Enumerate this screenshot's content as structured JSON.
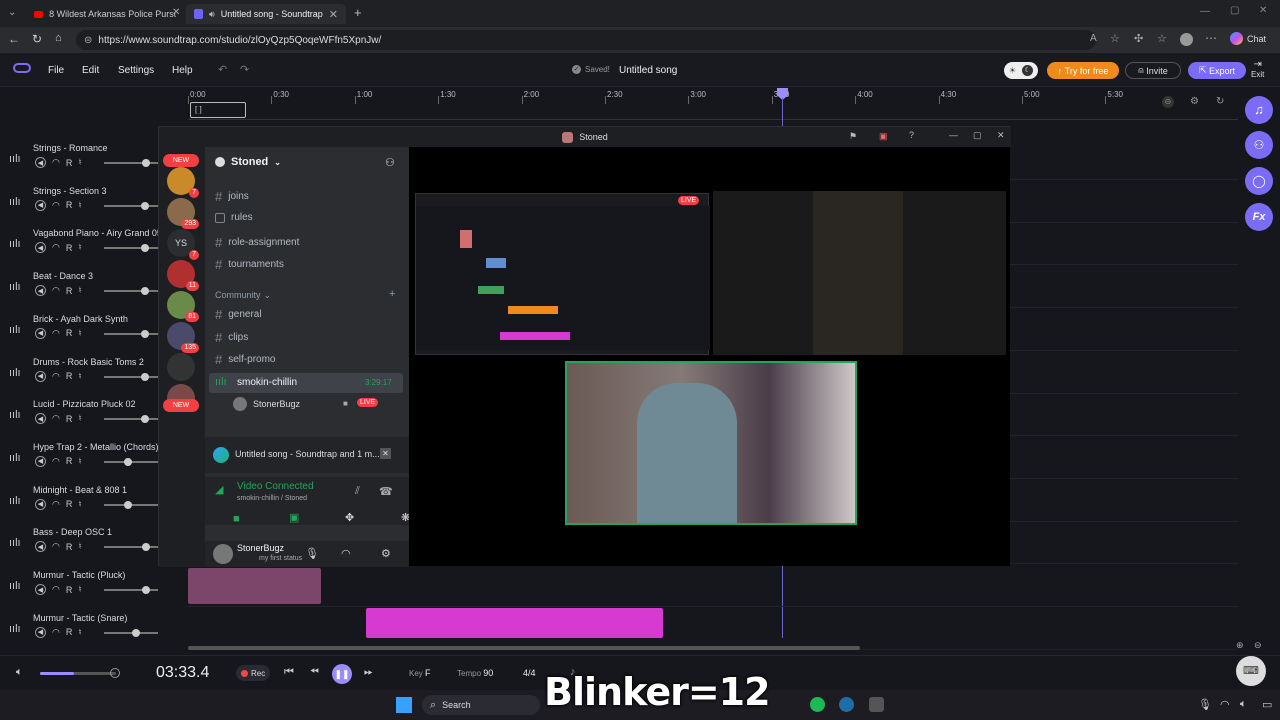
{
  "browser": {
    "tabs": [
      {
        "label": "8 Wildest Arkansas Police Pursuits"
      },
      {
        "label": "Untitled song - Soundtrap"
      }
    ],
    "url": "https://www.soundtrap.com/studio/zlOyQzp5QoqeWFfn5XpnJw/",
    "chat_label": "Chat"
  },
  "app": {
    "menu": [
      "File",
      "Edit",
      "Settings",
      "Help"
    ],
    "saved_label": "Saved!",
    "song_title": "Untitled song",
    "try_label": "Try for free",
    "invite_label": "Invite",
    "export_label": "Export",
    "exit_label": "Exit",
    "timeline_ticks": [
      "0:00",
      "0:30",
      "1:00",
      "1:30",
      "2:00",
      "2:30",
      "3:00",
      "3:30",
      "4:00",
      "4:30",
      "5:00",
      "5:30"
    ],
    "loop_label": "[ ]",
    "side_tools_fx": "Fx"
  },
  "tracks": [
    {
      "name": "Strings - Romance",
      "volume": 0.78
    },
    {
      "name": "Strings - Section 3",
      "volume": 0.75
    },
    {
      "name": "Vagabond Piano - Airy Grand 05",
      "volume": 0.75
    },
    {
      "name": "Beat - Dance 3",
      "volume": 0.75
    },
    {
      "name": "Brick - Ayah Dark Synth",
      "volume": 0.75
    },
    {
      "name": "Drums - Rock Basic Toms 2",
      "volume": 0.75
    },
    {
      "name": "Lucid - Pizzicato Pluck 02",
      "volume": 0.75
    },
    {
      "name": "Hype Trap 2 - Metallio (Chords)",
      "volume": 0.45
    },
    {
      "name": "Midnight - Beat & 808 1",
      "volume": 0.45
    },
    {
      "name": "Bass - Deep OSC 1",
      "volume": 0.78
    },
    {
      "name": "Murmur - Tactic (Pluck)",
      "volume": 0.78
    },
    {
      "name": "Murmur - Tactic (Snare)",
      "volume": 0.6
    }
  ],
  "track_ctrl": {
    "r": "R"
  },
  "discord": {
    "window_title": "Stoned",
    "server_name": "Stoned",
    "new_badge": "NEW",
    "server_badges": [
      "7",
      "293",
      "7",
      "11",
      "81",
      "135"
    ],
    "server_initials": "YS",
    "channels": [
      "joins",
      "rules",
      "role-assignment",
      "tournaments"
    ],
    "category": "Community",
    "community_channels": [
      "general",
      "clips",
      "self-promo"
    ],
    "voice_channel": "smokin-chillin",
    "voice_time": "3:29:17",
    "voice_user": "StonerBugz",
    "live_label": "LIVE",
    "stream_title": "Untitled song - Soundtrap and 1 m...",
    "connected_label": "Video Connected",
    "connected_sub": "smokin-chillin / Stoned",
    "user_name": "StonerBugz",
    "user_status": "my first status"
  },
  "transport": {
    "time": "03:33.4",
    "rec_label": "Rec",
    "key_label": "Key",
    "key_value": "F",
    "tempo_label": "Tempo",
    "tempo_value": "90",
    "sig": "4/4",
    "master_volume": 0.45
  },
  "overlay": {
    "text": "Blinker=12"
  },
  "taskbar": {
    "search_label": "Search"
  },
  "colors": {
    "accent": "#7b6cf6",
    "orange": "#f08a1c",
    "pink_clip": "#d63ad0",
    "discord_green": "#23a55a"
  }
}
